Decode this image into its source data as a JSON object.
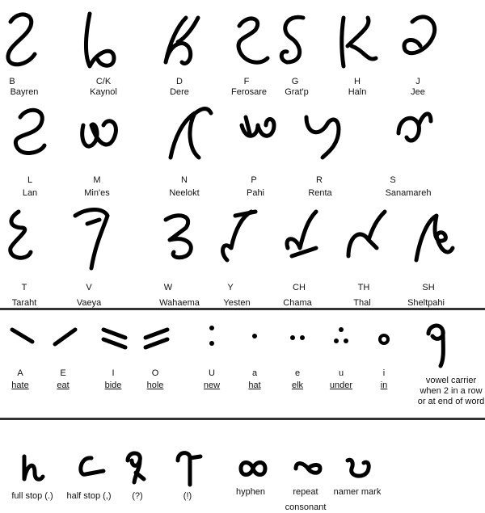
{
  "consonants": [
    {
      "letter": "B",
      "name": "Bayren"
    },
    {
      "letter": "C/K",
      "name": "Kaynol"
    },
    {
      "letter": "D",
      "name": "Dere"
    },
    {
      "letter": "F",
      "name": "Ferosare"
    },
    {
      "letter": "G",
      "name": "Grat'p"
    },
    {
      "letter": "H",
      "name": "Haln"
    },
    {
      "letter": "J",
      "name": "Jee"
    },
    {
      "letter": "L",
      "name": "Lan"
    },
    {
      "letter": "M",
      "name": "Min'es"
    },
    {
      "letter": "N",
      "name": "Neelokt"
    },
    {
      "letter": "P",
      "name": "Pahi"
    },
    {
      "letter": "R",
      "name": "Renta"
    },
    {
      "letter": "S",
      "name": "Sanamareh"
    },
    {
      "letter": "T",
      "name": "Taraht"
    },
    {
      "letter": "V",
      "name": "Vaeya"
    },
    {
      "letter": "W",
      "name": "Wahaema"
    },
    {
      "letter": "Y",
      "name": "Yesten"
    },
    {
      "letter": "CH",
      "name": "Chama"
    },
    {
      "letter": "TH",
      "name": "Thal"
    },
    {
      "letter": "SH",
      "name": "Sheltpahi"
    }
  ],
  "vowels": [
    {
      "letter": "A",
      "word": "hate"
    },
    {
      "letter": "E",
      "word": "eat"
    },
    {
      "letter": "I",
      "word": "bide"
    },
    {
      "letter": "O",
      "word": "hole"
    },
    {
      "letter": "U",
      "word": "new"
    },
    {
      "letter": "a",
      "word": "hat"
    },
    {
      "letter": "e",
      "word": "elk"
    },
    {
      "letter": "u",
      "word": "under"
    },
    {
      "letter": "i",
      "word": "in"
    }
  ],
  "vowel_carrier": [
    "vowel carrier",
    "when 2 in a row",
    "or at end of word"
  ],
  "punctuation": [
    {
      "label": "full stop (.)"
    },
    {
      "label": "half stop (,)"
    },
    {
      "label": "(?)"
    },
    {
      "label": "(!)"
    },
    {
      "label": "hyphen"
    },
    {
      "label": "repeat",
      "label2": "consonant"
    },
    {
      "label": "namer mark"
    }
  ]
}
